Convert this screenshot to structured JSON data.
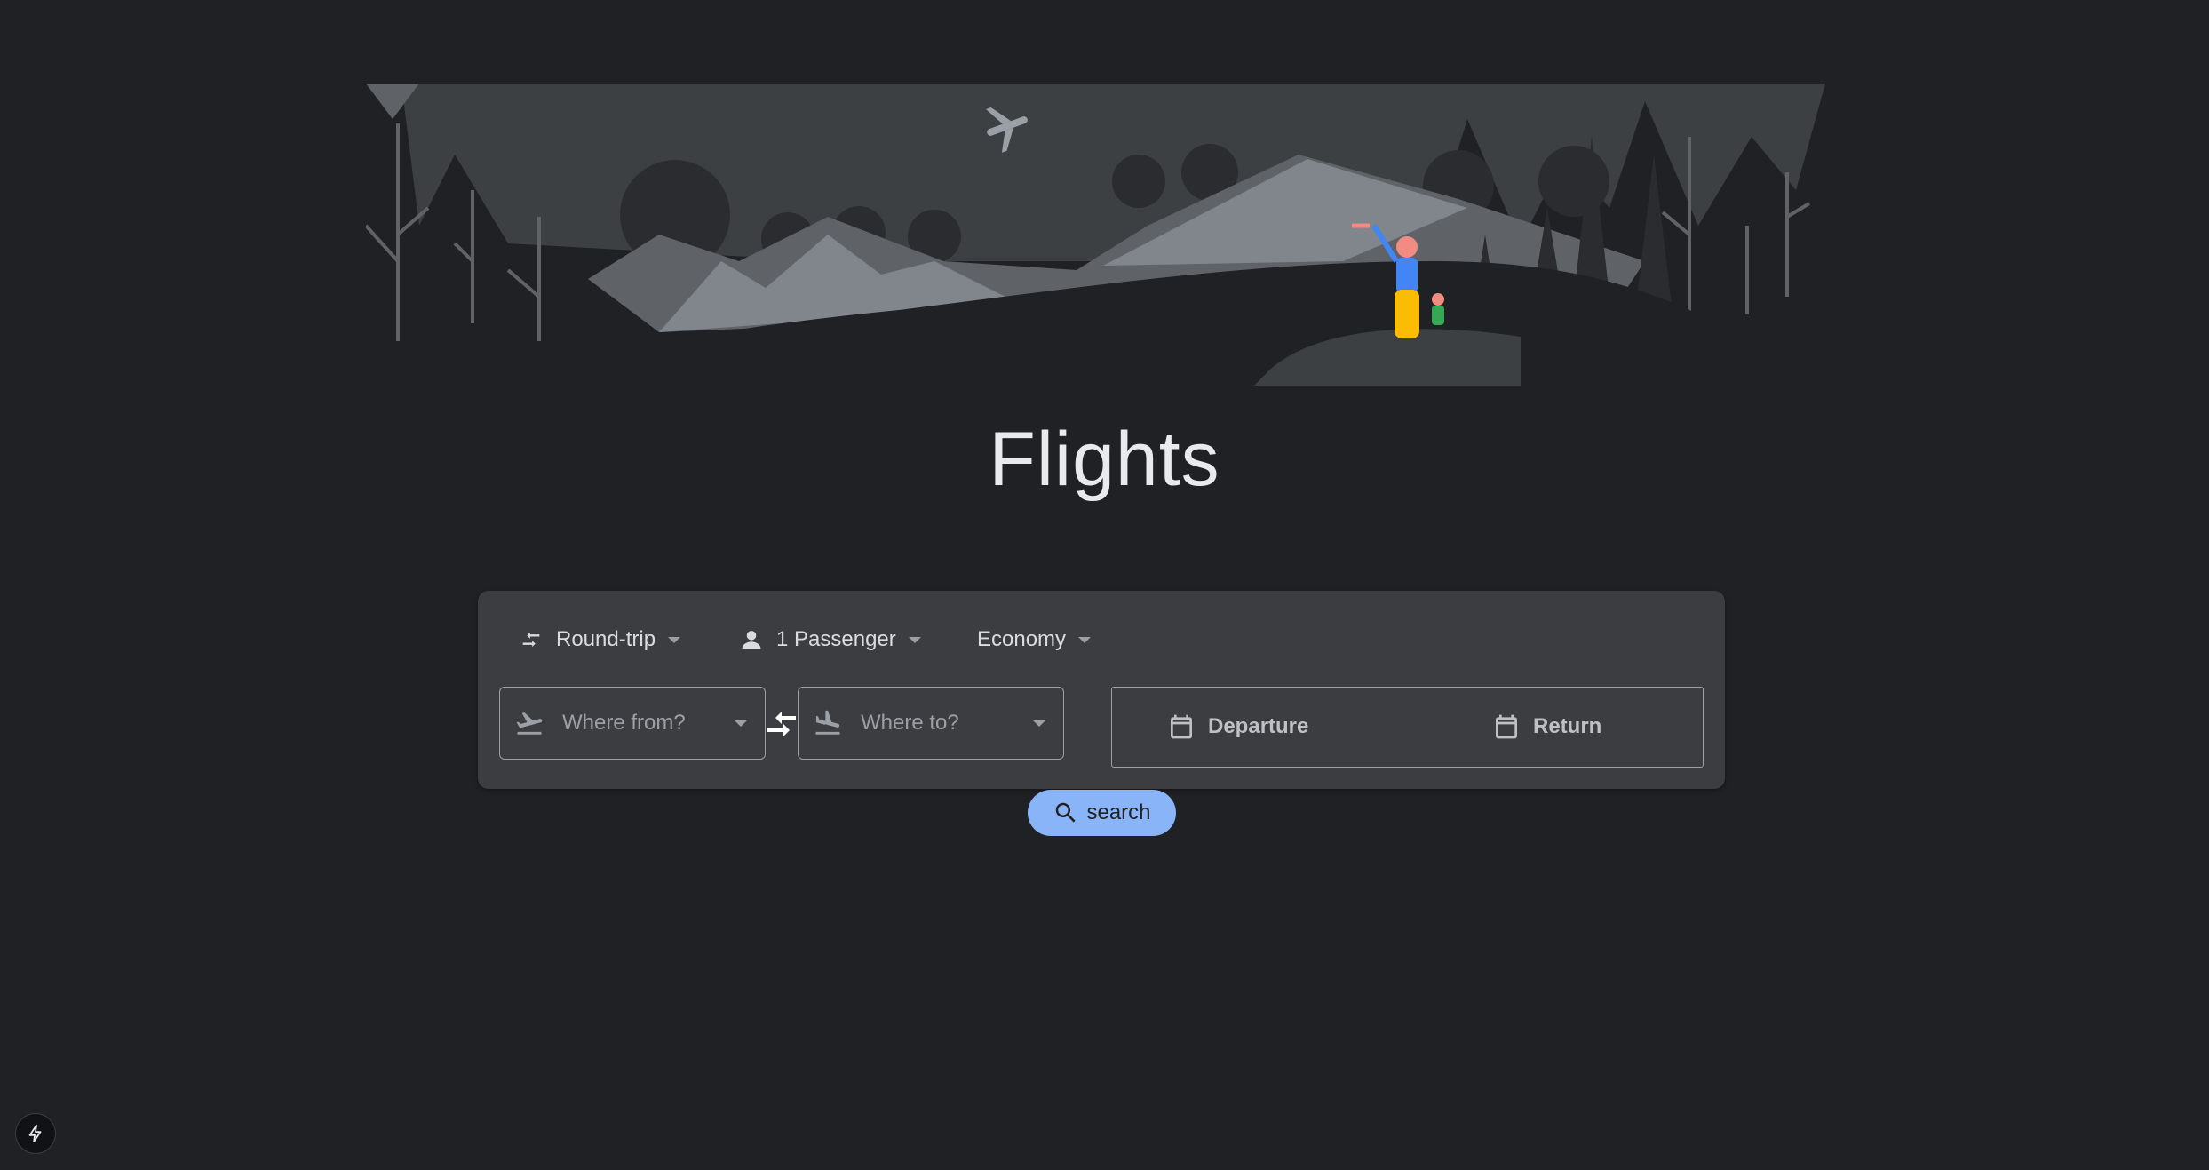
{
  "page": {
    "title": "Flights"
  },
  "options": {
    "trip_type": {
      "label": "Round-trip",
      "icon": "swap-horiz-icon"
    },
    "passengers": {
      "label": "1 Passenger",
      "icon": "person-icon"
    },
    "cabin_class": {
      "label": "Economy"
    }
  },
  "route": {
    "from": {
      "placeholder": "Where from?",
      "icon": "flight-takeoff-icon"
    },
    "to": {
      "placeholder": "Where to?",
      "icon": "flight-land-icon"
    },
    "swap_icon": "swap-icon"
  },
  "dates": {
    "departure_label": "Departure",
    "return_label": "Return",
    "icon": "calendar-icon"
  },
  "search": {
    "label": "search",
    "icon": "search-icon"
  },
  "corner_badge": {
    "icon": "lightning-icon"
  },
  "colors": {
    "background": "#202124",
    "panel": "#3c3d40",
    "accent": "#8ab4f8",
    "text": "#e8eaed",
    "muted": "#9aa0a6"
  }
}
